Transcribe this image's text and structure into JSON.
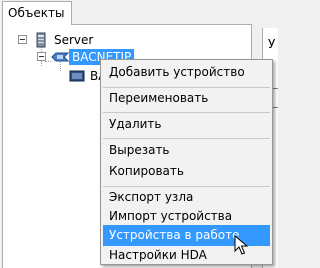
{
  "tabs": [
    {
      "label": "Объекты"
    }
  ],
  "tree": {
    "root_label": "Server",
    "selected_label": "BACNETIP",
    "child_label": "BA"
  },
  "right_panel": {
    "label": "У"
  },
  "context_menu": {
    "items": [
      {
        "label": "Добавить устройство"
      },
      {
        "label": "Переименовать"
      },
      {
        "label": "Удалить"
      },
      {
        "label": "Вырезать"
      },
      {
        "label": "Копировать"
      },
      {
        "label": "Экспорт узла"
      },
      {
        "label": "Импорт устройства"
      },
      {
        "label": "Устройства в работе"
      },
      {
        "label": "Настройки HDA"
      }
    ],
    "highlighted": "Устройства в работе"
  },
  "colors": {
    "selection": "#3399ff",
    "menu_background": "#f2f2f2"
  },
  "icons": [
    "collapse-icon",
    "server-icon",
    "network-icon",
    "device-icon",
    "mouse-pointer-icon"
  ]
}
